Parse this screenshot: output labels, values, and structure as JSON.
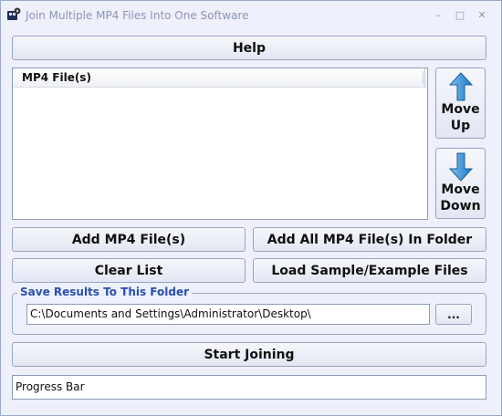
{
  "window": {
    "title": "Join Multiple MP4 Files Into One Software",
    "minimize_glyph": "–",
    "maximize_glyph": "□",
    "close_glyph": "✕"
  },
  "buttons": {
    "help": "Help",
    "move_up_line1": "Move",
    "move_up_line2": "Up",
    "move_down_line1": "Move",
    "move_down_line2": "Down",
    "add_files": "Add MP4 File(s)",
    "add_all_folder": "Add All MP4 File(s) In Folder",
    "clear_list": "Clear List",
    "load_sample": "Load Sample/Example Files",
    "browse": "...",
    "start_joining": "Start Joining"
  },
  "file_list": {
    "column_header": "MP4 File(s)",
    "items": []
  },
  "output": {
    "group_label": "Save Results To This Folder",
    "folder_path": "C:\\Documents and Settings\\Administrator\\Desktop\\"
  },
  "progress": {
    "label": "Progress Bar"
  },
  "colors": {
    "window_bg": "#eef1fb",
    "group_label": "#2a4fb0",
    "arrow_blue": "#2f8fd6"
  },
  "icons": {
    "app": "film-reel-icon",
    "move_up": "arrow-up-icon",
    "move_down": "arrow-down-icon"
  }
}
